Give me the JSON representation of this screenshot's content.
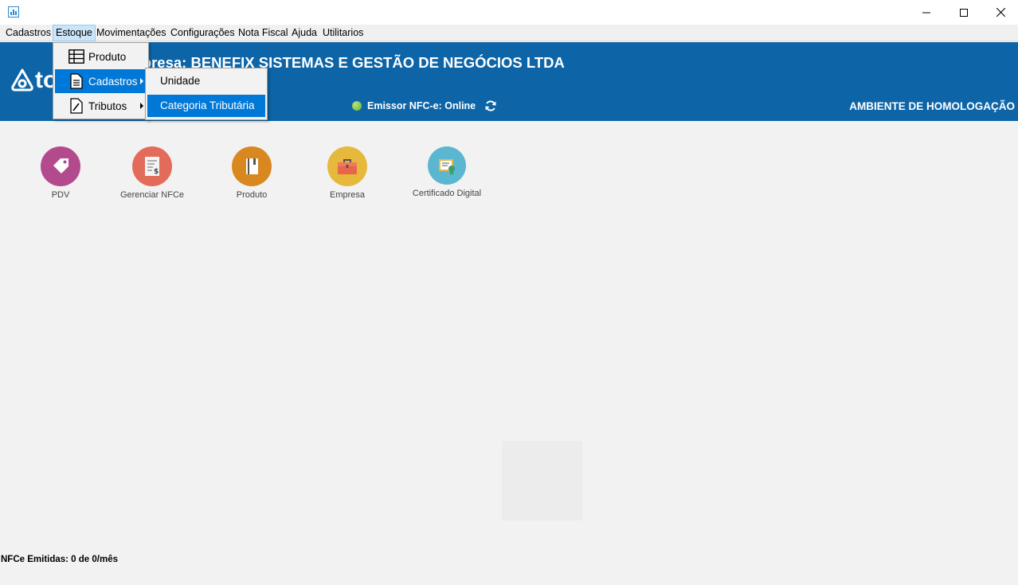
{
  "window": {
    "controls": [
      "minimize-icon",
      "maximize-icon",
      "close-icon"
    ]
  },
  "menubar": {
    "items": [
      "Cadastros",
      "Estoque",
      "Movimentações",
      "Configurações",
      "Nota Fiscal",
      "Ajuda",
      "Utilitarios"
    ],
    "active": "Estoque"
  },
  "header": {
    "logo_text": "to",
    "company": "Empresa: BENEFIX SISTEMAS E GESTÃO DE NEGÓCIOS LTDA",
    "emissor_status": "Emissor NFC-e: Online",
    "ambiente": "AMBIENTE DE HOMOLOGAÇÃO"
  },
  "estoque_menu": {
    "items": [
      {
        "label": "Produto",
        "icon": "grid-list-icon"
      },
      {
        "label": "Cadastros",
        "icon": "document-icon",
        "submenu": true,
        "highlighted": true
      },
      {
        "label": "Tributos",
        "icon": "edit-document-icon",
        "submenu": true
      }
    ]
  },
  "cadastros_submenu": {
    "items": [
      {
        "label": "Unidade"
      },
      {
        "label": "Categoria Tributária",
        "highlighted": true
      }
    ]
  },
  "shortcuts": [
    {
      "label": "PDV",
      "icon": "tag-icon",
      "color": "#b34a8d"
    },
    {
      "label": "Gerenciar NFCe",
      "icon": "receipt-icon",
      "color": "#e36b5a"
    },
    {
      "label": "Produto",
      "icon": "book-icon",
      "color": "#d9881f"
    },
    {
      "label": "Empresa",
      "icon": "briefcase-icon",
      "color": "#e6b83c"
    },
    {
      "label": "Certificado Digital",
      "icon": "certificate-icon",
      "color": "#5bb6cf"
    }
  ],
  "status_bar": {
    "nfce_count": "NFCe Emitidas: 0 de 0/mês"
  },
  "colors": {
    "header_bg": "#0d65a8",
    "menu_highlight": "#0078d7",
    "status_online": "#7cc13a"
  }
}
